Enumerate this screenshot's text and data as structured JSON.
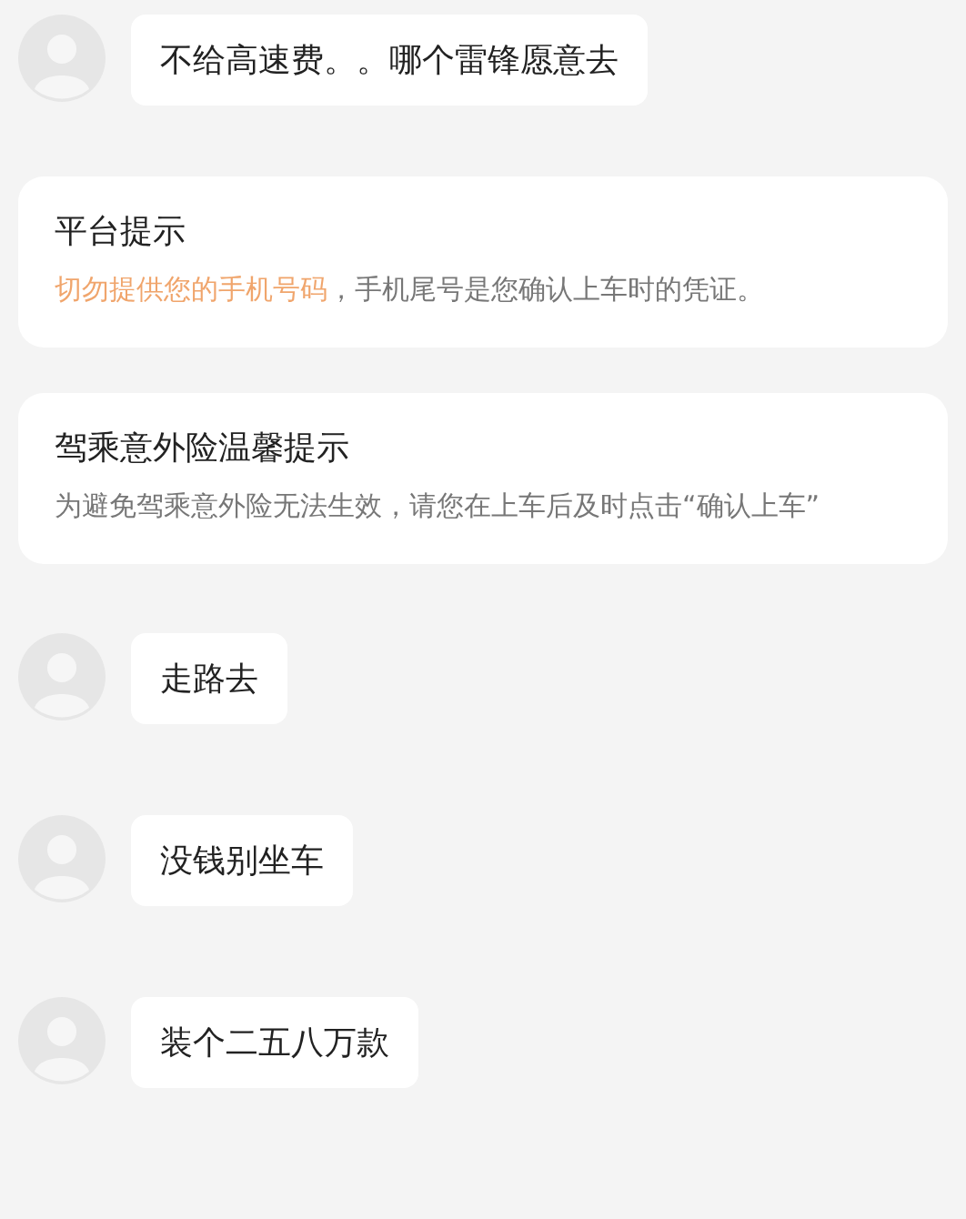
{
  "items": [
    {
      "kind": "message",
      "text": "不给高速费。。哪个雷锋愿意去"
    },
    {
      "kind": "notice",
      "title": "平台提示",
      "highlight": "切勿提供您的手机号码",
      "text": "，手机尾号是您确认上车时的凭证。"
    },
    {
      "kind": "notice",
      "title": "驾乘意外险温馨提示",
      "text": "为避免驾乘意外险无法生效，请您在上车后及时点击“确认上车”"
    },
    {
      "kind": "message",
      "text": "走路去"
    },
    {
      "kind": "message",
      "text": "没钱别坐车"
    },
    {
      "kind": "message",
      "text": "装个二五八万款"
    }
  ]
}
